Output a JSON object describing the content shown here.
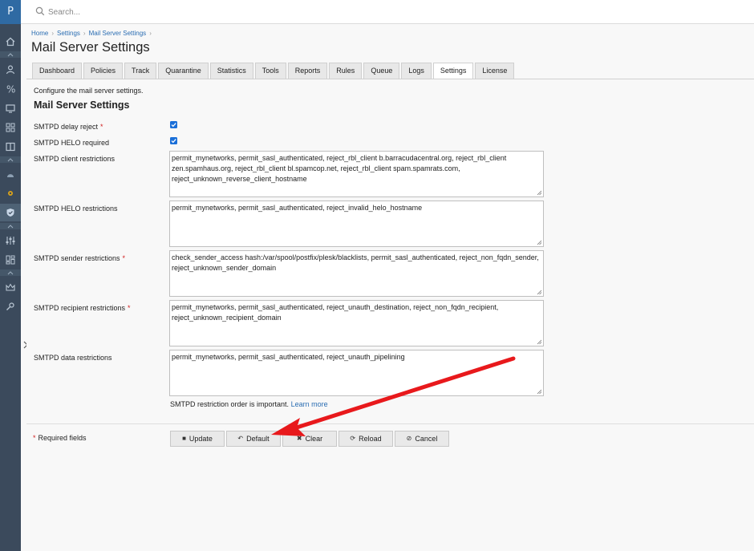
{
  "app": {
    "logo_letter": "P"
  },
  "search": {
    "placeholder": "Search..."
  },
  "breadcrumb": [
    "Home",
    "Settings",
    "Mail Server Settings"
  ],
  "page_title": "Mail Server Settings",
  "tabs": [
    {
      "label": "Dashboard",
      "active": false
    },
    {
      "label": "Policies",
      "active": false
    },
    {
      "label": "Track",
      "active": false
    },
    {
      "label": "Quarantine",
      "active": false
    },
    {
      "label": "Statistics",
      "active": false
    },
    {
      "label": "Tools",
      "active": false
    },
    {
      "label": "Reports",
      "active": false
    },
    {
      "label": "Rules",
      "active": false
    },
    {
      "label": "Queue",
      "active": false
    },
    {
      "label": "Logs",
      "active": false
    },
    {
      "label": "Settings",
      "active": true
    },
    {
      "label": "License",
      "active": false
    }
  ],
  "description": "Configure the mail server settings.",
  "section_title": "Mail Server Settings",
  "fields": {
    "delay_reject": {
      "label": "SMTPD delay reject",
      "required": "*",
      "checked": true
    },
    "helo_required": {
      "label": "SMTPD HELO required",
      "checked": true
    },
    "client_restrictions": {
      "label": "SMTPD client restrictions",
      "value": "permit_mynetworks, permit_sasl_authenticated, reject_rbl_client b.barracudacentral.org, reject_rbl_client zen.spamhaus.org, reject_rbl_client bl.spamcop.net, reject_rbl_client spam.spamrats.com, reject_unknown_reverse_client_hostname"
    },
    "helo_restrictions": {
      "label": "SMTPD HELO restrictions",
      "value": "permit_mynetworks, permit_sasl_authenticated, reject_invalid_helo_hostname"
    },
    "sender_restrictions": {
      "label": "SMTPD sender restrictions",
      "required": "*",
      "value": "check_sender_access hash:/var/spool/postfix/plesk/blacklists, permit_sasl_authenticated, reject_non_fqdn_sender, reject_unknown_sender_domain"
    },
    "recipient_restrictions": {
      "label": "SMTPD recipient restrictions",
      "required": "*",
      "value": "permit_mynetworks, permit_sasl_authenticated, reject_unauth_destination, reject_non_fqdn_recipient, reject_unknown_recipient_domain"
    },
    "data_restrictions": {
      "label": "SMTPD data restrictions",
      "value": "permit_mynetworks, permit_sasl_authenticated, reject_unauth_pipelining"
    }
  },
  "hint": {
    "text": "SMTPD restriction order is important.",
    "link": "Learn more"
  },
  "required_note": {
    "star": "*",
    "text": "Required fields"
  },
  "buttons": {
    "update": "Update",
    "default": "Default",
    "clear": "Clear",
    "reload": "Reload",
    "cancel": "Cancel"
  },
  "colors": {
    "sidebar": "#3b4a5c",
    "link": "#2a6db2",
    "required": "#d02020",
    "checkbox": "#1a6fd8",
    "annotation_arrow": "#e8191c"
  }
}
